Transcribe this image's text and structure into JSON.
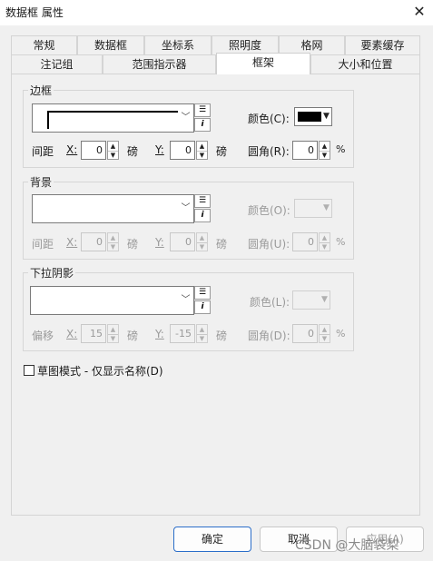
{
  "window": {
    "title": "数据框 属性"
  },
  "tabs_row1": [
    "常规",
    "数据框",
    "坐标系",
    "照明度",
    "格网",
    "要素缓存"
  ],
  "tabs_row2": [
    "注记组",
    "范围指示器",
    "框架",
    "大小和位置"
  ],
  "active_tab": "框架",
  "border": {
    "legend": "边框",
    "color_label": "颜色(C):",
    "color_value": "#000000",
    "gap_label": "间距",
    "x_label": "X:",
    "x_value": "0",
    "x_unit": "磅",
    "y_label": "Y:",
    "y_value": "0",
    "y_unit": "磅",
    "corner_label": "圆角(R):",
    "corner_value": "0",
    "corner_unit": "%"
  },
  "background": {
    "legend": "背景",
    "color_label": "颜色(O):",
    "gap_label": "间距",
    "x_label": "X:",
    "x_value": "0",
    "x_unit": "磅",
    "y_label": "Y:",
    "y_value": "0",
    "y_unit": "磅",
    "corner_label": "圆角(U):",
    "corner_value": "0",
    "corner_unit": "%"
  },
  "shadow": {
    "legend": "下拉阴影",
    "color_label": "颜色(L):",
    "offset_label": "偏移",
    "x_label": "X:",
    "x_value": "15",
    "x_unit": "磅",
    "y_label": "Y:",
    "y_value": "-15",
    "y_unit": "磅",
    "corner_label": "圆角(D):",
    "corner_value": "0",
    "corner_unit": "%"
  },
  "draft_mode": {
    "label": "草图模式 - 仅显示名称(D)",
    "checked": false
  },
  "buttons": {
    "ok": "确定",
    "cancel": "取消",
    "apply": "应用(A)"
  },
  "watermark": "CSDN @大脑袋梨",
  "icons": {
    "symbol_selector": "list-icon",
    "properties": "info-icon",
    "dropdown": "chevron-down-icon"
  }
}
